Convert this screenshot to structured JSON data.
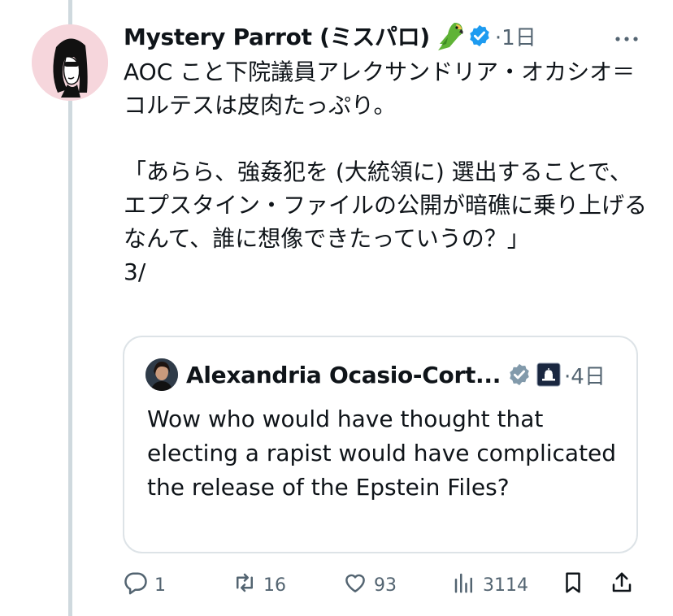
{
  "tweet": {
    "display_name": "Mystery Parrot (ミスパロ)",
    "time": "·1日",
    "text": "AOC こと下院議員アレクサンドリア・オカシオ＝コルテスは皮肉たっぷり。\n\n「あらら、強姦犯を (大統領に) 選出することで、エプスタイン・ファイルの公開が暗礁に乗り上げるなんて、誰に想像できたっていうの？」\n3/",
    "icons": [
      "parrot-emoji-icon",
      "verified-badge-icon",
      "more-options-icon"
    ]
  },
  "quote": {
    "display_name": "Alexandria Ocasio-Cort...",
    "time": "·4日",
    "text": "Wow who would have thought that electing a rapist would have complicated the release of the Epstein Files?",
    "icons": [
      "verified-badge-icon",
      "capitol-affiliate-icon"
    ]
  },
  "actions": {
    "reply_count": "1",
    "repost_count": "16",
    "like_count": "93",
    "views_count": "3114"
  },
  "colors": {
    "verified": "#1d9bf0",
    "quote_verified": "#829aab",
    "secondary_text": "#536471",
    "thread_line": "#cfd9de"
  }
}
